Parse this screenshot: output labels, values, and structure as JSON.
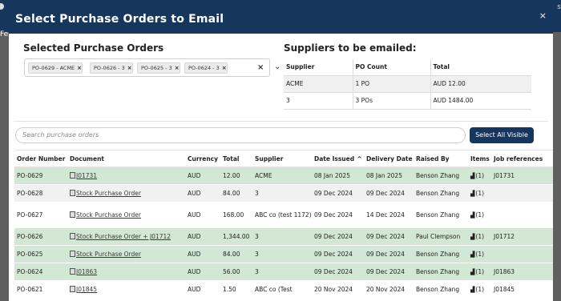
{
  "modal": {
    "title": "Select Purchase Orders to Email",
    "close_label": "×"
  },
  "background": {
    "fragment_left": "Fe",
    "fragment_right": "s"
  },
  "selected_section": {
    "title": "Selected Purchase Orders",
    "chips": [
      {
        "label": "PO-0629 - ACME",
        "remove": "×"
      },
      {
        "label": "PO-0626 - 3",
        "remove": "×"
      },
      {
        "label": "PO-0625 - 3",
        "remove": "×"
      },
      {
        "label": "PO-0624 - 3",
        "remove": "×"
      }
    ],
    "clear_label": "×",
    "caret_label": "⌄"
  },
  "suppliers_section": {
    "title": "Suppliers to be emailed:",
    "headers": [
      "Supplier",
      "PO Count",
      "Total"
    ],
    "rows": [
      [
        "ACME",
        "1 PO",
        "AUD 12.00"
      ],
      [
        "3",
        "3 POs",
        "AUD 1484.00"
      ]
    ]
  },
  "search": {
    "placeholder": "Search purchase orders"
  },
  "select_all_label": "Select All Visible",
  "po_table": {
    "headers": [
      "Order Number",
      "Document",
      "Currency",
      "Total",
      "Supplier",
      "Date Issued",
      "Delivery Date",
      "Raised By",
      "Items",
      "Job references"
    ],
    "sort_indicator": "^",
    "rows": [
      {
        "state": "green",
        "order": "PO-0629",
        "document": "J01731",
        "currency": "AUD",
        "total": "12.00",
        "supplier": "ACME",
        "issued": "08 Jan 2025",
        "delivery": "08 Jan 2025",
        "raised_by": "Benson Zhang",
        "items": "(1)",
        "job_ref": "J01731"
      },
      {
        "state": "grey",
        "order": "PO-0628",
        "document": "Stock Purchase Order",
        "currency": "AUD",
        "total": "84.00",
        "supplier": "3",
        "issued": "09 Dec 2024",
        "delivery": "09 Dec 2024",
        "raised_by": "Benson Zhang",
        "items": "(1)",
        "job_ref": ""
      },
      {
        "state": "white",
        "order": "PO-0627",
        "document": "Stock Purchase Order",
        "currency": "AUD",
        "total": "168.00",
        "supplier": "ABC co (test 1172)",
        "issued": "09 Dec 2024",
        "delivery": "14 Dec 2024",
        "raised_by": "Benson Zhang",
        "items": "(1)",
        "job_ref": ""
      },
      {
        "state": "green",
        "order": "PO-0626",
        "document": "Stock Purchase Order + J01712",
        "currency": "AUD",
        "total": "1,344.00",
        "supplier": "3",
        "issued": "09 Dec 2024",
        "delivery": "09 Dec 2024",
        "raised_by": "Paul Clempson",
        "items": "(1)",
        "job_ref": "J01712"
      },
      {
        "state": "green",
        "order": "PO-0625",
        "document": "Stock Purchase Order",
        "currency": "AUD",
        "total": "84.00",
        "supplier": "3",
        "issued": "09 Dec 2024",
        "delivery": "09 Dec 2024",
        "raised_by": "Benson Zhang",
        "items": "(1)",
        "job_ref": ""
      },
      {
        "state": "green",
        "order": "PO-0624",
        "document": "J01863",
        "currency": "AUD",
        "total": "56.00",
        "supplier": "3",
        "issued": "09 Dec 2024",
        "delivery": "09 Dec 2024",
        "raised_by": "Benson Zhang",
        "items": "(1)",
        "job_ref": "J01863"
      },
      {
        "state": "white",
        "order": "PO-0621",
        "document": "J01845",
        "currency": "AUD",
        "total": "1.50",
        "supplier": "ABC co (Test",
        "issued": "20 Nov 2024",
        "delivery": "20 Nov 2024",
        "raised_by": "Benson Zhang",
        "items": "(1)",
        "job_ref": "J01845"
      }
    ]
  }
}
